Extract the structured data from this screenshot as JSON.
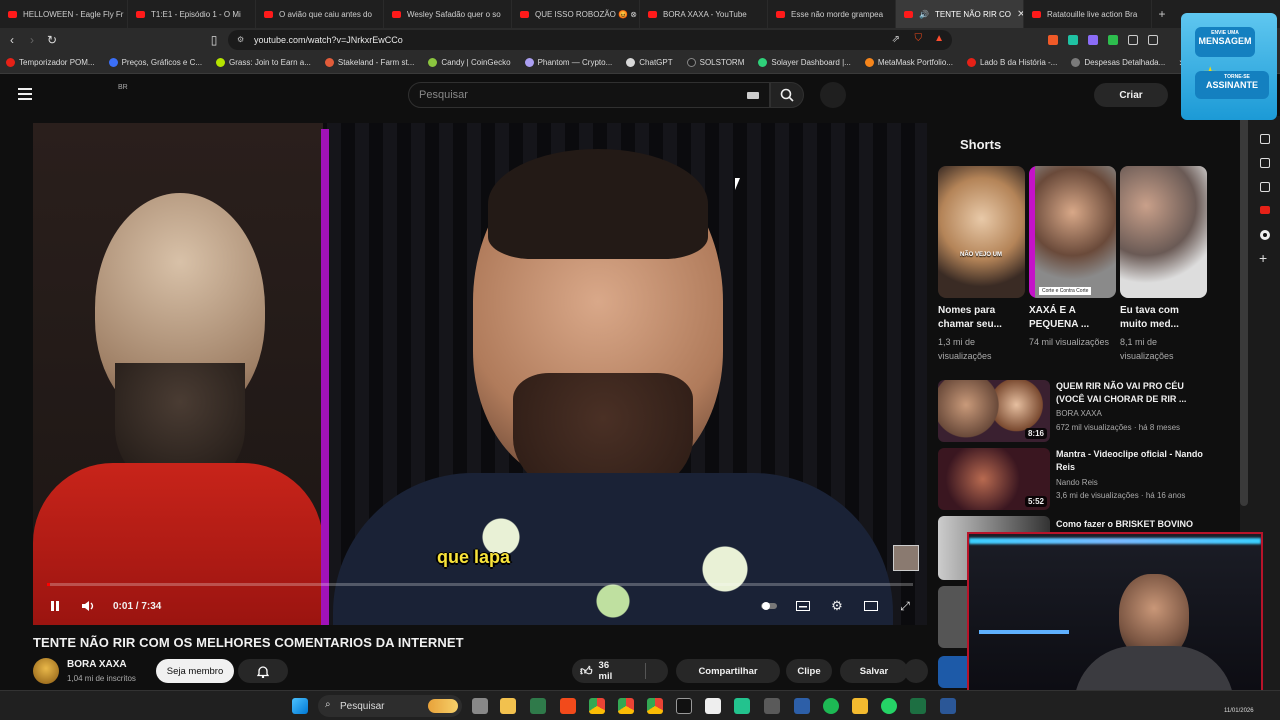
{
  "browser": {
    "tabs": [
      {
        "title": "HELLOWEEN - Eagle Fly Fr"
      },
      {
        "title": "T1:E1 - Episódio 1 - O Mi"
      },
      {
        "title": "O avião que caiu antes do"
      },
      {
        "title": "Wesley Safadão quer o so"
      },
      {
        "title": "QUE ISSO ROBOZÃO 😡 ⊗"
      },
      {
        "title": "BORA XAXA - YouTube"
      },
      {
        "title": "Esse não morde grampea"
      },
      {
        "title": "TENTE NÃO RIR CO",
        "active": true
      },
      {
        "title": "Ratatouille live action Bra"
      }
    ],
    "url": "youtube.com/watch?v=JNrkxrEwCCo",
    "bookmarks": [
      {
        "label": "Temporizador POM...",
        "color": "#e62117"
      },
      {
        "label": "Preços, Gráficos e C...",
        "color": "#3b6ff7"
      },
      {
        "label": "Grass: Join to Earn a...",
        "color": "#b6e400"
      },
      {
        "label": "Stakeland - Farm st...",
        "color": "#e25c3a"
      },
      {
        "label": "Candy | CoinGecko",
        "color": "#8bc53f"
      },
      {
        "label": "Phantom — Crypto...",
        "color": "#ab9ff2"
      },
      {
        "label": "ChatGPT",
        "color": "#d9d9d9"
      },
      {
        "label": "SOLSTORM",
        "color": "#222222"
      },
      {
        "label": "Solayer Dashboard |...",
        "color": "#2fd17a"
      },
      {
        "label": "MetaMask Portfolio...",
        "color": "#f6851b"
      },
      {
        "label": "Lado B da História -...",
        "color": "#e62117"
      },
      {
        "label": "Despesas Detalhada...",
        "color": "#7a7a7a"
      }
    ]
  },
  "youtube": {
    "country": "BR",
    "search_placeholder": "Pesquisar",
    "create_label": "Criar",
    "video": {
      "title": "TENTE NÃO RIR COM OS MELHORES COMENTARIOS DA INTERNET",
      "caption": "que lapa",
      "time": "0:01 / 7:34",
      "progress": 0.003
    },
    "channel": {
      "name": "BORA XAXA",
      "subscribers": "1,04 mi de inscritos",
      "member_label": "Seja membro"
    },
    "actions": {
      "likes": "36 mil",
      "share": "Compartilhar",
      "clip": "Clipe",
      "save": "Salvar"
    },
    "shorts_title": "Shorts",
    "shorts": [
      {
        "title": "Nomes para chamar seu...",
        "views": "1,3 mi de visualizações",
        "overlay": "NÃO VEJO UM"
      },
      {
        "title": "XAXÁ E A PEQUENA ...",
        "views": "74 mil visualizações",
        "overlay": "Corte e Contra Corte"
      },
      {
        "title": "Eu tava com muito med...",
        "views": "8,1 mi de visualizações",
        "overlay": ""
      }
    ],
    "recommended": [
      {
        "title": "QUEM RIR NÃO VAI PRO CÉU (VOCÊ VAI CHORAR DE RIR ...",
        "channel": "BORA XAXA",
        "meta": "672 mil visualizações · há 8 meses",
        "duration": "8:16"
      },
      {
        "title": "Mantra - Videoclipe oficial - Nando Reis",
        "channel": "Nando Reis",
        "meta": "3,6 mi de visualizações · há 16 anos",
        "duration": "5:52"
      },
      {
        "title": "Como fazer o BRISKET BOVINO",
        "channel": "",
        "meta": "",
        "duration": ""
      }
    ]
  },
  "promo": {
    "line1": "ENVIE UMA",
    "line2": "MENSAGEM",
    "line3": "TORNE-SE",
    "line4": "ASSINANTE"
  },
  "taskbar": {
    "search_label": "Pesquisar",
    "date": "11/01/2026"
  }
}
